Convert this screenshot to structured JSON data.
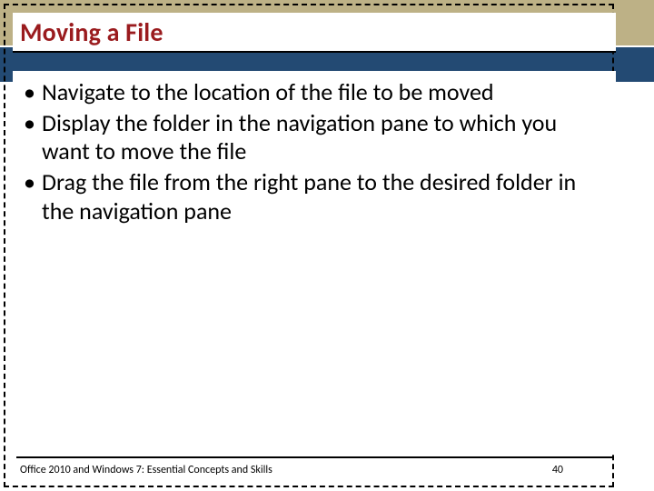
{
  "title": "Moving a File",
  "bullets": [
    "Navigate to the location of the file to be moved",
    "Display the folder in the navigation pane to which you want to move the file",
    "Drag the file from the right pane to the desired folder in the navigation pane"
  ],
  "footer": "Office 2010 and Windows 7: Essential Concepts and Skills",
  "page_number": "40",
  "colors": {
    "accent_khaki": "#bdb186",
    "accent_navy": "#234a73",
    "title_red": "#9a1b1e"
  }
}
